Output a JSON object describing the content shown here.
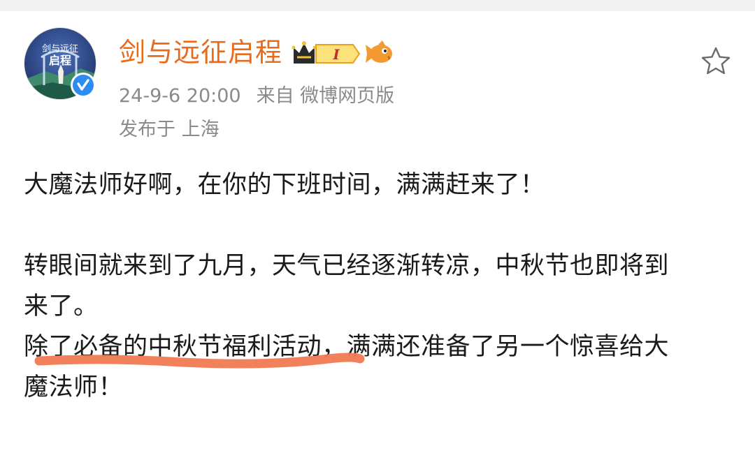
{
  "post": {
    "username": "剑与远征启程",
    "avatar_text_top": "剑与远征",
    "avatar_text_bottom": "启程",
    "level_badge": "I",
    "date": "24-9-6 20:00",
    "source": "来自 微博网页版",
    "location": "发布于 上海",
    "content": {
      "line1": "大魔法师好啊，在你的下班时间，满满赶来了！",
      "line2": "转眼间就来到了九月，天气已经逐渐转凉，中秋节也即将到",
      "line3": "来了。",
      "line4": "除了必备的中秋节福利活动，满满还准备了另一个惊喜给大",
      "line5": "魔法师！"
    }
  },
  "colors": {
    "username": "#e86b1c",
    "meta": "#8a8a8a",
    "verified": "#2d8cf0",
    "annotation": "#f07a52"
  },
  "icons": {
    "verified": "verified-check-icon",
    "star": "star-outline-icon",
    "crown": "crown-icon",
    "fish": "fish-emoji-icon"
  }
}
